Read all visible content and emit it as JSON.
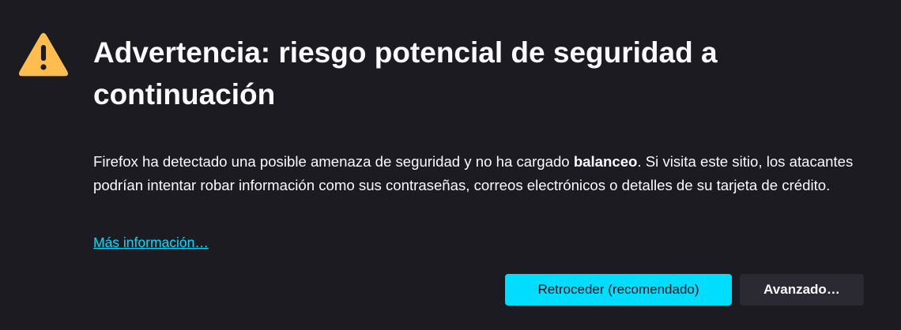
{
  "title": "Advertencia: riesgo potencial de seguridad a continuación",
  "description": {
    "before": "Firefox ha detectado una posible amenaza de seguridad y no ha cargado ",
    "site": "balanceo",
    "after": ". Si visita este sitio, los atacantes podrían intentar robar información como sus contraseñas, correos electrónicos o detalles de su tarjeta de crédito."
  },
  "learn_more": "Más información…",
  "buttons": {
    "go_back": "Retroceder (recomendado)",
    "advanced": "Avanzado…"
  },
  "icons": {
    "warning": "warning-triangle-icon"
  },
  "colors": {
    "background": "#1c1b22",
    "warning": "#ffbd4f",
    "accent": "#00ddff",
    "secondary_button": "#2b2a33"
  }
}
